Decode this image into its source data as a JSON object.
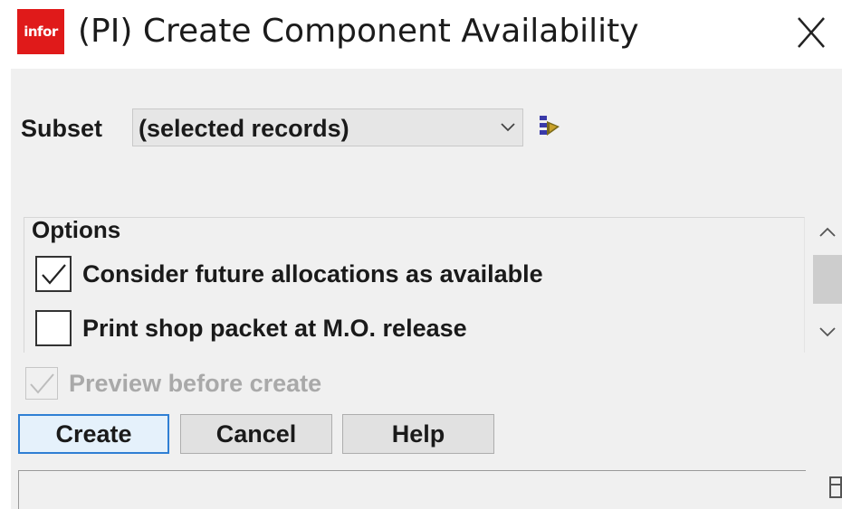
{
  "window": {
    "logo_text": "infor",
    "title": "(PI) Create Component Availability",
    "close_icon": "close-icon"
  },
  "subset": {
    "label": "Subset",
    "value": "(selected records)",
    "filter_icon": "filter-icon"
  },
  "options": {
    "legend": "Options",
    "items": [
      {
        "label": "Consider future allocations as available",
        "checked": true
      },
      {
        "label": "Print shop packet at M.O. release",
        "checked": false
      }
    ]
  },
  "preview": {
    "label": "Preview before create",
    "checked": true,
    "disabled": true
  },
  "buttons": {
    "create": "Create",
    "cancel": "Cancel",
    "help": "Help"
  },
  "colors": {
    "brand_red": "#e01a1a",
    "focus_blue": "#2f7fd4",
    "dialog_bg": "#f0f0f0"
  }
}
